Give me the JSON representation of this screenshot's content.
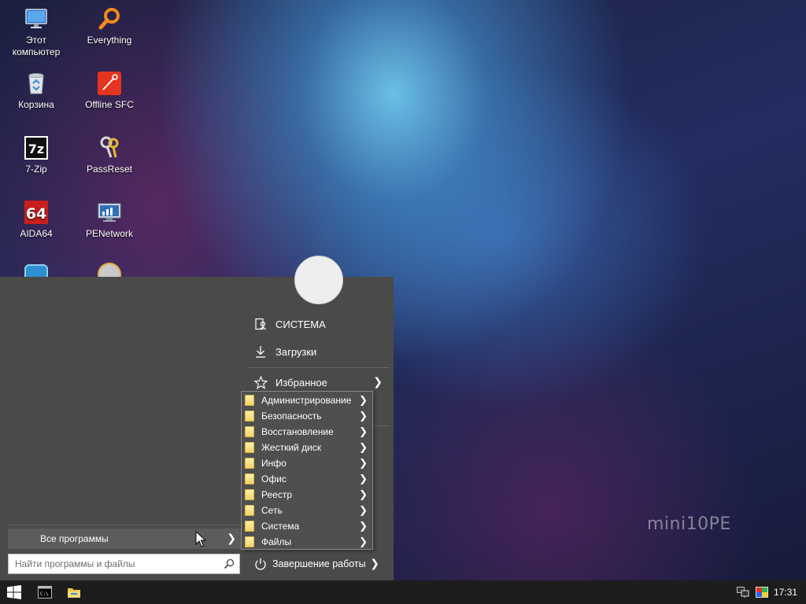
{
  "desktop": {
    "icons": [
      {
        "label": "Этот компьютер",
        "icon": "computer-icon"
      },
      {
        "label": "Everything",
        "icon": "search-magnifier-icon"
      },
      {
        "label": "Корзина",
        "icon": "recycle-bin-icon"
      },
      {
        "label": "Offline SFC",
        "icon": "offline-sfc-icon"
      },
      {
        "label": "7-Zip",
        "icon": "7zip-icon"
      },
      {
        "label": "PassReset",
        "icon": "keys-icon"
      },
      {
        "label": "AIDA64",
        "icon": "aida64-icon"
      },
      {
        "label": "PENetwork",
        "icon": "network-monitor-icon"
      }
    ],
    "watermark": "mini10PE"
  },
  "start_menu": {
    "right_items": [
      {
        "label": "СИСТЕМА",
        "icon": "user-folder-icon"
      },
      {
        "label": "Загрузки",
        "icon": "download-icon"
      },
      {
        "label": "Избранное",
        "icon": "star-icon"
      }
    ],
    "submenu_items": [
      "Администрирование",
      "Безопасность",
      "Восстановление",
      "Жесткий диск",
      "Инфо",
      "Офис",
      "Реестр",
      "Сеть",
      "Система",
      "Файлы"
    ],
    "all_programs_label": "Все программы",
    "search_placeholder": "Найти программы и файлы",
    "shutdown_label": "Завершение работы"
  },
  "taskbar": {
    "items": [
      "start-button",
      "cmd-icon",
      "explorer-icon"
    ],
    "tray_icons": [
      "network-icon",
      "color-icon"
    ],
    "clock": "17:31"
  },
  "colors": {
    "menu_bg": "#4a4a48",
    "taskbar_bg": "#1d1d1d",
    "submenu_bg": "#4f4f4d"
  }
}
